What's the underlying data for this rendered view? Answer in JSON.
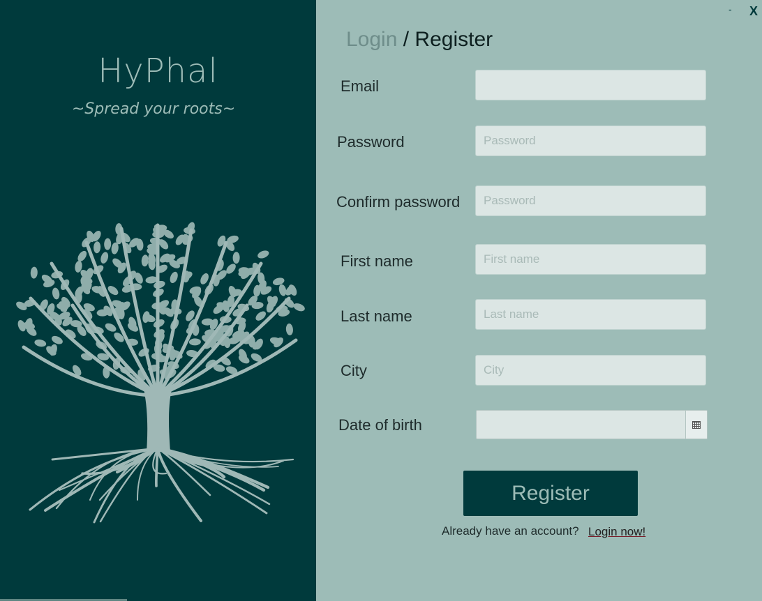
{
  "brand": {
    "title": "HyPhal",
    "tagline": "~Spread your roots~",
    "panel_color": "#003a3c",
    "accent_color": "#9dbcb7"
  },
  "window": {
    "minimize_label": "-",
    "close_label": "X"
  },
  "heading": {
    "login": "Login",
    "separator": " / ",
    "register": "Register"
  },
  "form": {
    "email": {
      "label": "Email",
      "value": "",
      "placeholder": ""
    },
    "password": {
      "label": "Password",
      "value": "",
      "placeholder": "Password"
    },
    "confirm_password": {
      "label": "Confirm password",
      "value": "",
      "placeholder": "Password"
    },
    "first_name": {
      "label": "First name",
      "value": "",
      "placeholder": "First name"
    },
    "last_name": {
      "label": "Last name",
      "value": "",
      "placeholder": "Last name"
    },
    "city": {
      "label": "City",
      "value": "",
      "placeholder": "City"
    },
    "date_of_birth": {
      "label": "Date of birth",
      "value": "",
      "icon": "calendar-icon"
    }
  },
  "actions": {
    "register_label": "Register",
    "account_prompt": "Already have an account?",
    "login_now_label": "Login now!"
  }
}
